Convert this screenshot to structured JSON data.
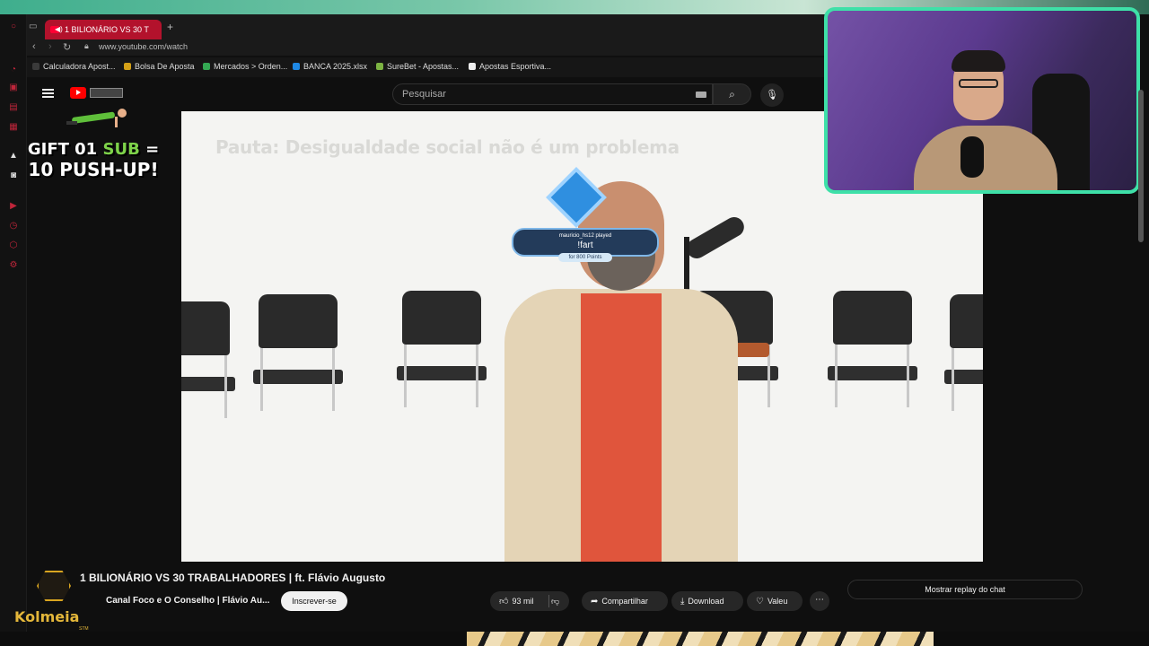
{
  "browser": {
    "tab_title": "1 BILIONÁRIO VS 30 T",
    "new_tab": "+",
    "url": "www.youtube.com/watch",
    "bookmarks": [
      {
        "label": "Calculadora Apost...",
        "color": "#3a3a3a"
      },
      {
        "label": "Bolsa De Aposta",
        "color": "#d4a017"
      },
      {
        "label": "Mercados > Orden...",
        "color": "#34a853"
      },
      {
        "label": "BANCA 2025.xlsx",
        "color": "#1e88e5"
      },
      {
        "label": "SureBet - Apostas...",
        "color": "#7cb342"
      },
      {
        "label": "Apostas Esportiva...",
        "color": "#eeeeee"
      }
    ]
  },
  "youtube": {
    "search_placeholder": "Pesquisar",
    "video_title": "1 BILIONÁRIO VS 30 TRABALHADORES | ft. Flávio Augusto",
    "channel": "Canal Foco e O Conselho | Flávio Au...",
    "subscribe": "Inscrever-se",
    "likes": "93 mil",
    "share": "Compartilhar",
    "download": "Download",
    "thanks": "Valeu",
    "show_chat_replay": "Mostrar replay do chat",
    "video_caption": "Pauta: Desigualdade social não é um problema"
  },
  "overlay": {
    "gift_line1_a": "GIFT 01 ",
    "gift_line1_b": "SUB",
    "gift_line1_c": " =",
    "gift_line2": "10 PUSH-UP!",
    "alert_user": "mauricio_hs12 played",
    "alert_command": "!fart",
    "alert_cost": "for 800 Points",
    "brand": "Kolmeia",
    "brand_sub": "STM"
  }
}
